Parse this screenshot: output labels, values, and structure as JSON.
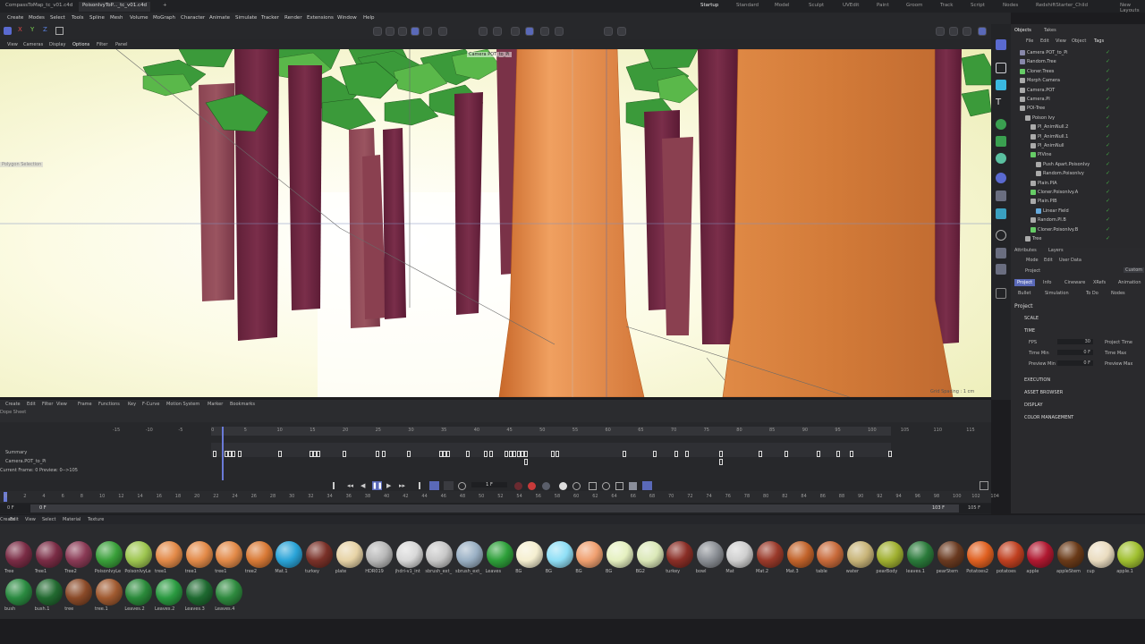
{
  "tabs": {
    "doc1": "CompassToMap_tc_v01.c4d",
    "doc2": "PoisonIvyToP..._tc_v01.c4d",
    "add": "+"
  },
  "layouts": [
    "Startup",
    "Standard",
    "Model",
    "Sculpt",
    "UVEdit",
    "Paint",
    "Groom",
    "Track",
    "Script",
    "Nodes",
    "RedshiftStarter_Child",
    "New Layouts"
  ],
  "menu": [
    "Create",
    "Modes",
    "Select",
    "Tools",
    "Spline",
    "Mesh",
    "Volume",
    "MoGraph",
    "Character",
    "Animate",
    "Simulate",
    "Tracker",
    "Render",
    "Extensions",
    "Window",
    "Help"
  ],
  "viewport_menu": [
    "View",
    "Cameras",
    "Display",
    "Options",
    "Filter",
    "Panel"
  ],
  "viewport": {
    "camera_label": "Camera POT_to_Pi",
    "selection_label": "Polygon Selection",
    "grid_label": "Grid Spacing : 1 cm",
    "cam_label_short": "Camera:POT"
  },
  "objects": {
    "tabs": [
      "Objects",
      "Takes"
    ],
    "menu": [
      "File",
      "Edit",
      "View",
      "Object",
      "Tags"
    ],
    "rows": [
      "Camera POT_to_Pi",
      "Random.Tree",
      "Cloner.Trees",
      "Morph Camera",
      "Camera.POT",
      "Camera.PI",
      "POI-Tree",
      "Poison Ivy",
      "PI_AnimNull.2",
      "PI_AnimNull.1",
      "PI_AnimNull",
      "PIVine",
      "Push Apart.PoisonIvy",
      "Random.PoisonIvy",
      "Plain.PIA",
      "Cloner.PoisonIvy.A",
      "Plain.PIB",
      "Linear Field",
      "Random.PI.B",
      "Cloner.PoisonIvy.B",
      "Tree"
    ]
  },
  "attributes": {
    "tabs": [
      "Attributes",
      "Layers"
    ],
    "menu": [
      "Mode",
      "Edit",
      "User Data"
    ],
    "object_label": "Project",
    "custom_btn": "Custom",
    "subtabs": [
      "Project",
      "Info",
      "Cineware",
      "XRefs",
      "Animation",
      "Bullet",
      "Simulation",
      "To Do",
      "Nodes"
    ],
    "section": "Project",
    "groups": [
      "SCALE",
      "TIME",
      "EXECUTION",
      "ASSET BROWSER",
      "DISPLAY",
      "COLOR MANAGEMENT"
    ],
    "fields": [
      {
        "label": "FPS",
        "value": "30"
      },
      {
        "label": "Time Min",
        "value": "0 F"
      },
      {
        "label": "Preview Min",
        "value": "0 F"
      }
    ],
    "fields_right": [
      "Project Time",
      "Time Max",
      "Preview Max"
    ]
  },
  "timeline": {
    "menu": [
      "Create",
      "Edit",
      "Filter",
      "View",
      "Frame",
      "Functions",
      "Key",
      "F-Curve",
      "Motion System",
      "Marker",
      "Bookmarks"
    ],
    "ruler": [
      "-15",
      "-10",
      "-5",
      "0",
      "5",
      "10",
      "15",
      "20",
      "25",
      "30",
      "35",
      "40",
      "45",
      "50",
      "55",
      "60",
      "65",
      "70",
      "75",
      "80",
      "85",
      "90",
      "95",
      "100",
      "105",
      "110",
      "115"
    ],
    "mode": "Dope Sheet",
    "tracks": [
      "Summary",
      "Camera.POT_to_Pi"
    ],
    "info": "Current Frame: 0  Preview: 0-->105"
  },
  "transport": {
    "frame": "1 F",
    "ruler": [
      "0",
      "2",
      "4",
      "6",
      "8",
      "10",
      "12",
      "14",
      "16",
      "18",
      "20",
      "22",
      "24",
      "26",
      "28",
      "30",
      "32",
      "34",
      "36",
      "38",
      "40",
      "42",
      "44",
      "46",
      "48",
      "50",
      "52",
      "54",
      "56",
      "58",
      "60",
      "62",
      "64",
      "66",
      "68",
      "70",
      "72",
      "74",
      "76",
      "78",
      "80",
      "82",
      "84",
      "86",
      "88",
      "90",
      "92",
      "94",
      "96",
      "98",
      "100",
      "102",
      "104"
    ],
    "start": "0 F",
    "preview_start": "0 F",
    "end": "103 F",
    "end2": "105 F"
  },
  "material_menu": [
    "Create",
    "Edit",
    "View",
    "Select",
    "Material",
    "Texture"
  ],
  "materials": [
    {
      "name": "Tree",
      "color": "#7a2c45"
    },
    {
      "name": "Tree1",
      "color": "#7a2c45"
    },
    {
      "name": "Tree2",
      "color": "#8a3a55"
    },
    {
      "name": "PoisonIvyLe",
      "color": "#3aa03a"
    },
    {
      "name": "PoisonIvyLe",
      "color": "#9ec650"
    },
    {
      "name": "tree1",
      "color": "#e38a48"
    },
    {
      "name": "tree1",
      "color": "#e38a48"
    },
    {
      "name": "tree1",
      "color": "#e38a48"
    },
    {
      "name": "tree2",
      "color": "#d97a36"
    },
    {
      "name": "Mat.1",
      "color": "#2aa4d8"
    },
    {
      "name": "turkey",
      "color": "#7a3128"
    },
    {
      "name": "plate",
      "color": "#e7d3a6"
    },
    {
      "name": "HDR019",
      "color": "#b8b8b8"
    },
    {
      "name": "jhdri-v1_int",
      "color": "#d8d8d8"
    },
    {
      "name": "sbrush_ext_",
      "color": "#c8c8c8"
    },
    {
      "name": "sbrush_ext_",
      "color": "#9ab0c4"
    },
    {
      "name": "Leaves",
      "color": "#2ea03a"
    },
    {
      "name": "BG",
      "color": "#f5efd0"
    },
    {
      "name": "BG",
      "color": "#8fdff6"
    },
    {
      "name": "BG",
      "color": "#f0a070"
    },
    {
      "name": "BG",
      "color": "#e5f0c0"
    },
    {
      "name": "BG2",
      "color": "#dbe8b8"
    },
    {
      "name": "turkey",
      "color": "#8a2e26"
    },
    {
      "name": "bowl",
      "color": "#8a8e94"
    },
    {
      "name": "Mat",
      "color": "#cfcfcf"
    },
    {
      "name": "Mat.2",
      "color": "#9a3a2a"
    },
    {
      "name": "Mat.3",
      "color": "#c2632a"
    },
    {
      "name": "table",
      "color": "#c86a3a"
    },
    {
      "name": "water",
      "color": "#c8b478"
    },
    {
      "name": "pearBody",
      "color": "#a0b030"
    },
    {
      "name": "leaves.1",
      "color": "#2a7a3a"
    },
    {
      "name": "pearStem",
      "color": "#6a3a20"
    },
    {
      "name": "Potatoes2",
      "color": "#e06020"
    },
    {
      "name": "potatoes",
      "color": "#c04020"
    },
    {
      "name": "apple",
      "color": "#b01830"
    },
    {
      "name": "appleStem",
      "color": "#6a3a18"
    },
    {
      "name": "cup",
      "color": "#eadcc0"
    },
    {
      "name": "apple.1",
      "color": "#a0c030"
    },
    {
      "name": "bush",
      "color": "#2a8a40"
    },
    {
      "name": "bush.1",
      "color": "#226a30"
    },
    {
      "name": "tree",
      "color": "#8a4a28"
    },
    {
      "name": "tree.1",
      "color": "#a05a30"
    },
    {
      "name": "Leaves.2",
      "color": "#2a8a3a"
    },
    {
      "name": "Leaves.2",
      "color": "#2a9a40"
    },
    {
      "name": "Leaves.3",
      "color": "#1e6a30"
    },
    {
      "name": "Leaves.4",
      "color": "#2e8a3e"
    }
  ]
}
